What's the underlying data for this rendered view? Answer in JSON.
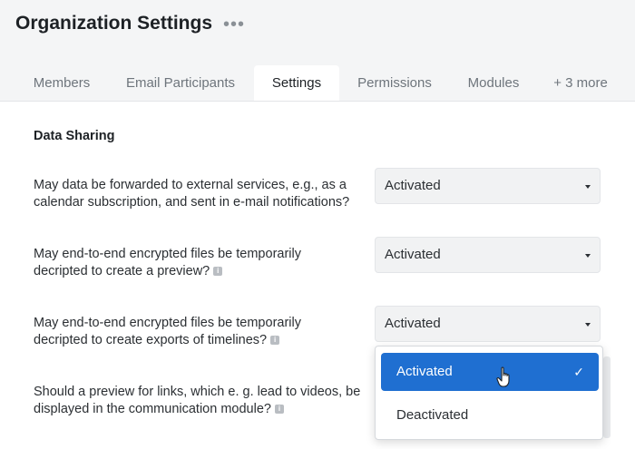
{
  "header": {
    "title": "Organization Settings",
    "more_icon": "ellipsis-icon"
  },
  "tabs": [
    {
      "label": "Members"
    },
    {
      "label": "Email Participants"
    },
    {
      "label": "Settings"
    },
    {
      "label": "Permissions"
    },
    {
      "label": "Modules"
    },
    {
      "label": "+ 3 more"
    }
  ],
  "active_tab": "Settings",
  "section": {
    "title": "Data Sharing"
  },
  "settings": [
    {
      "question_line1": "May data be forwarded to external services, e.g., as a",
      "question_line2": "calendar subscription, and sent in e-mail notifications?",
      "value": "Activated",
      "has_info": false
    },
    {
      "question_line1": "May end-to-end encrypted files be temporarily",
      "question_line2": "decripted to create a preview?",
      "value": "Activated",
      "has_info": true
    },
    {
      "question_line1": "May end-to-end encrypted files be temporarily",
      "question_line2": "decripted to create exports of timelines?",
      "value": "Activated",
      "has_info": true
    },
    {
      "question_line1": "Should a preview for links, which e. g. lead to videos, be",
      "question_line2": "displayed in the communication module?",
      "has_info": true
    }
  ],
  "dropdown": {
    "options": [
      {
        "label": "Activated",
        "selected": true
      },
      {
        "label": "Deactivated",
        "selected": false
      }
    ],
    "check_icon": "check-icon"
  },
  "colors": {
    "accent": "#1f6fd1",
    "header_bg": "#f4f5f6",
    "select_bg": "#f1f2f3"
  }
}
